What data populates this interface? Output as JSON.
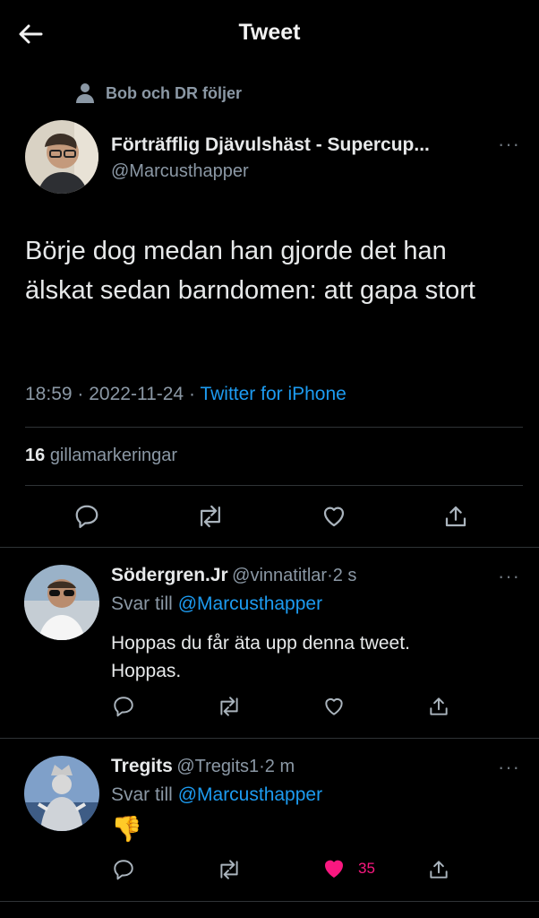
{
  "header": {
    "title": "Tweet"
  },
  "social_context": {
    "text": "Bob och DR följer"
  },
  "tweet": {
    "author_name": "Förträfflig Djävulshäst - Supercup...",
    "author_handle": "@Marcusthapper",
    "more": "···",
    "text": "Börje dog medan han gjorde det han älskat sedan barndomen: att gapa stort",
    "time": "18:59",
    "date": "2022-11-24",
    "sep": "·",
    "source": "Twitter for iPhone",
    "likes_count": "16",
    "likes_label": "gillamarkeringar"
  },
  "replies": [
    {
      "name": "Södergren.Jr",
      "handle": "@vinnatitlar",
      "time": "2 s",
      "reply_prefix": "Svar till",
      "reply_to": "@Marcusthapper",
      "text_line1": "Hoppas du får äta upp denna tweet.",
      "text_line2": "Hoppas.",
      "more": "···"
    },
    {
      "name": "Tregits",
      "handle": "@Tregits1",
      "time": "2 m",
      "reply_prefix": "Svar till",
      "reply_to": "@Marcusthapper",
      "text": "👎",
      "like_count": "35",
      "more": "···"
    }
  ],
  "colors": {
    "accent": "#1d9bf0",
    "like": "#f91880",
    "muted": "#8b98a5"
  },
  "icons": [
    "back-arrow-icon",
    "person-icon",
    "reply-icon",
    "retweet-icon",
    "like-icon",
    "share-icon"
  ]
}
